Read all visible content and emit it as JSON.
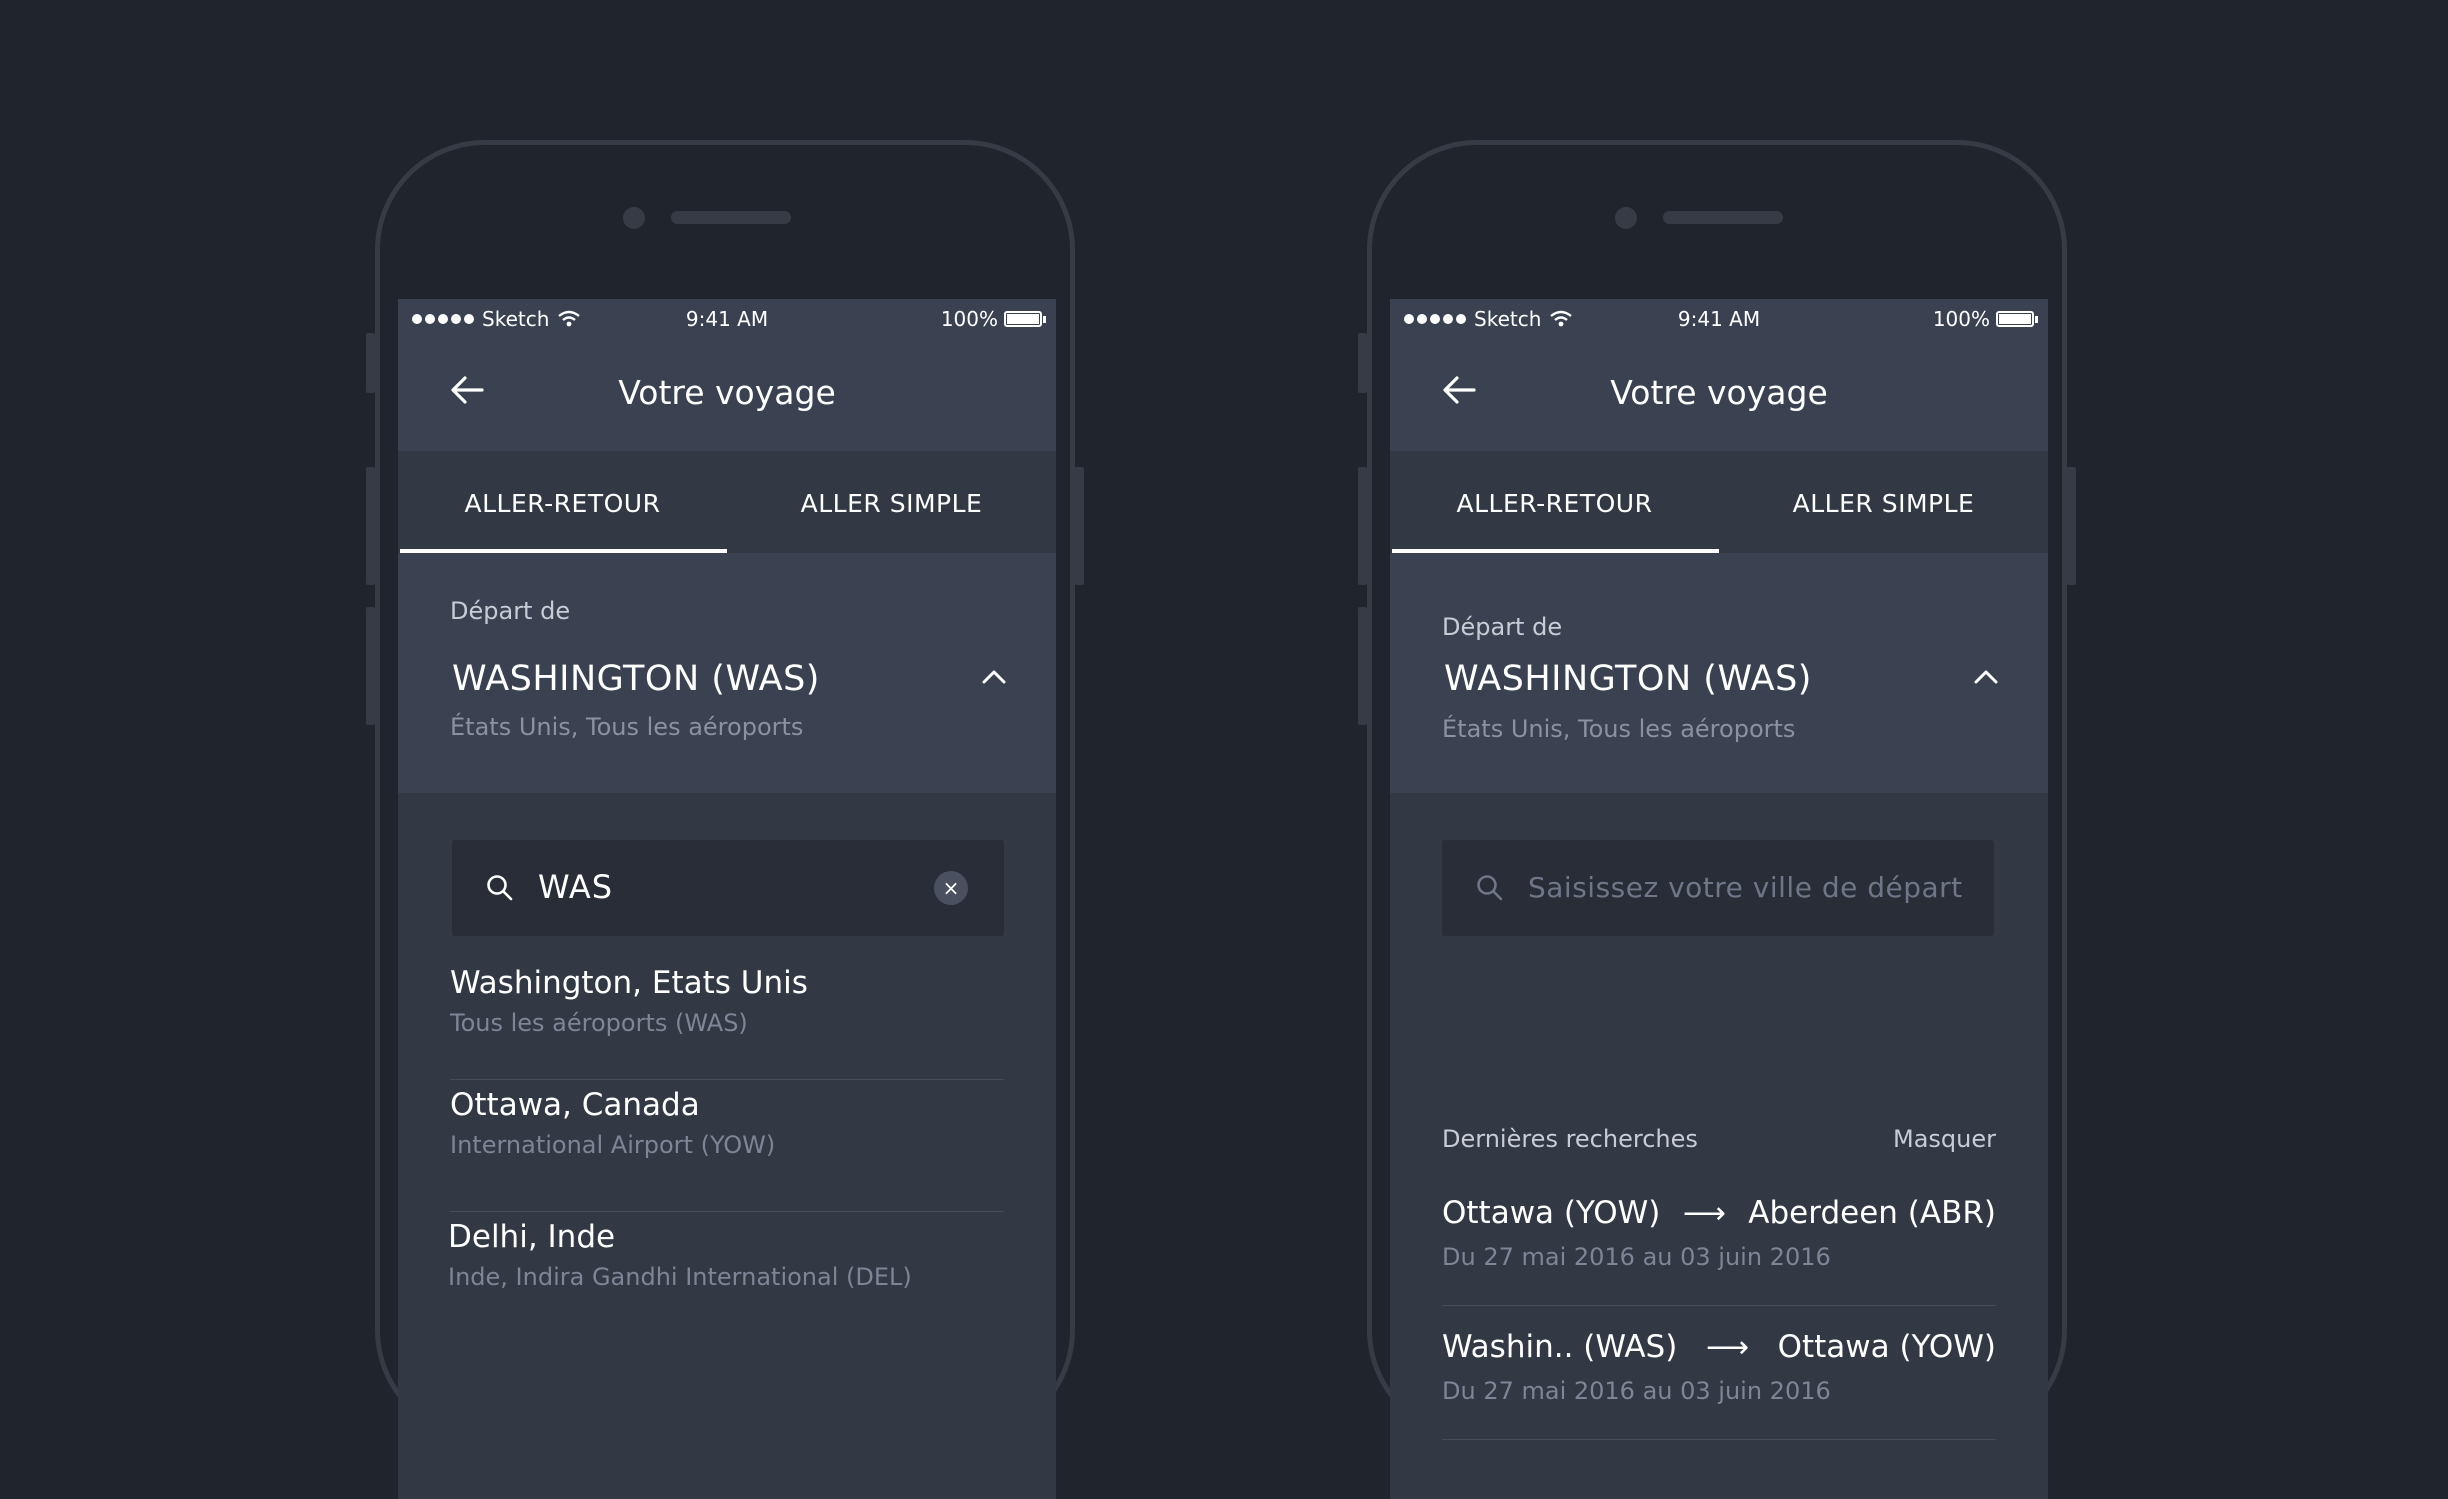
{
  "status_bar": {
    "carrier": "Sketch",
    "time": "9:41 AM",
    "battery": "100%"
  },
  "nav": {
    "title": "Votre voyage"
  },
  "tabs": [
    {
      "label": "ALLER-RETOUR",
      "active": true
    },
    {
      "label": "ALLER SIMPLE",
      "active": false
    }
  ],
  "depart": {
    "label": "Départ de",
    "value": "WASHINGTON (WAS)",
    "sub": "États Unis, Tous les aéroports"
  },
  "left_screen": {
    "search_value": "WAS",
    "clear_label": "×",
    "results": [
      {
        "title": "Washington, Etats Unis",
        "sub": "Tous les aéroports (WAS)"
      },
      {
        "title": "Ottawa, Canada",
        "sub": "International Airport (YOW)"
      },
      {
        "title": "Delhi, Inde",
        "sub": "Inde, Indira Gandhi International (DEL)"
      }
    ]
  },
  "right_screen": {
    "search_placeholder": "Saisissez votre ville de départ",
    "recent_title": "Dernières recherches",
    "hide_label": "Masquer",
    "recent": [
      {
        "from": "Ottawa (YOW)",
        "arrow": "⟶",
        "to": "Aberdeen (ABR)",
        "dates": "Du 27 mai 2016 au 03 juin 2016"
      },
      {
        "from": "Washin.. (WAS)",
        "arrow": "⟶",
        "to": "Ottawa (YOW)",
        "dates": "Du 27 mai 2016 au 03 juin 2016"
      }
    ]
  },
  "colors": {
    "background": "#20242c",
    "header": "#3a4252",
    "surface": "#323844",
    "search_field": "#282d37",
    "text_primary": "#ffffff",
    "text_secondary": "#7d8596"
  }
}
